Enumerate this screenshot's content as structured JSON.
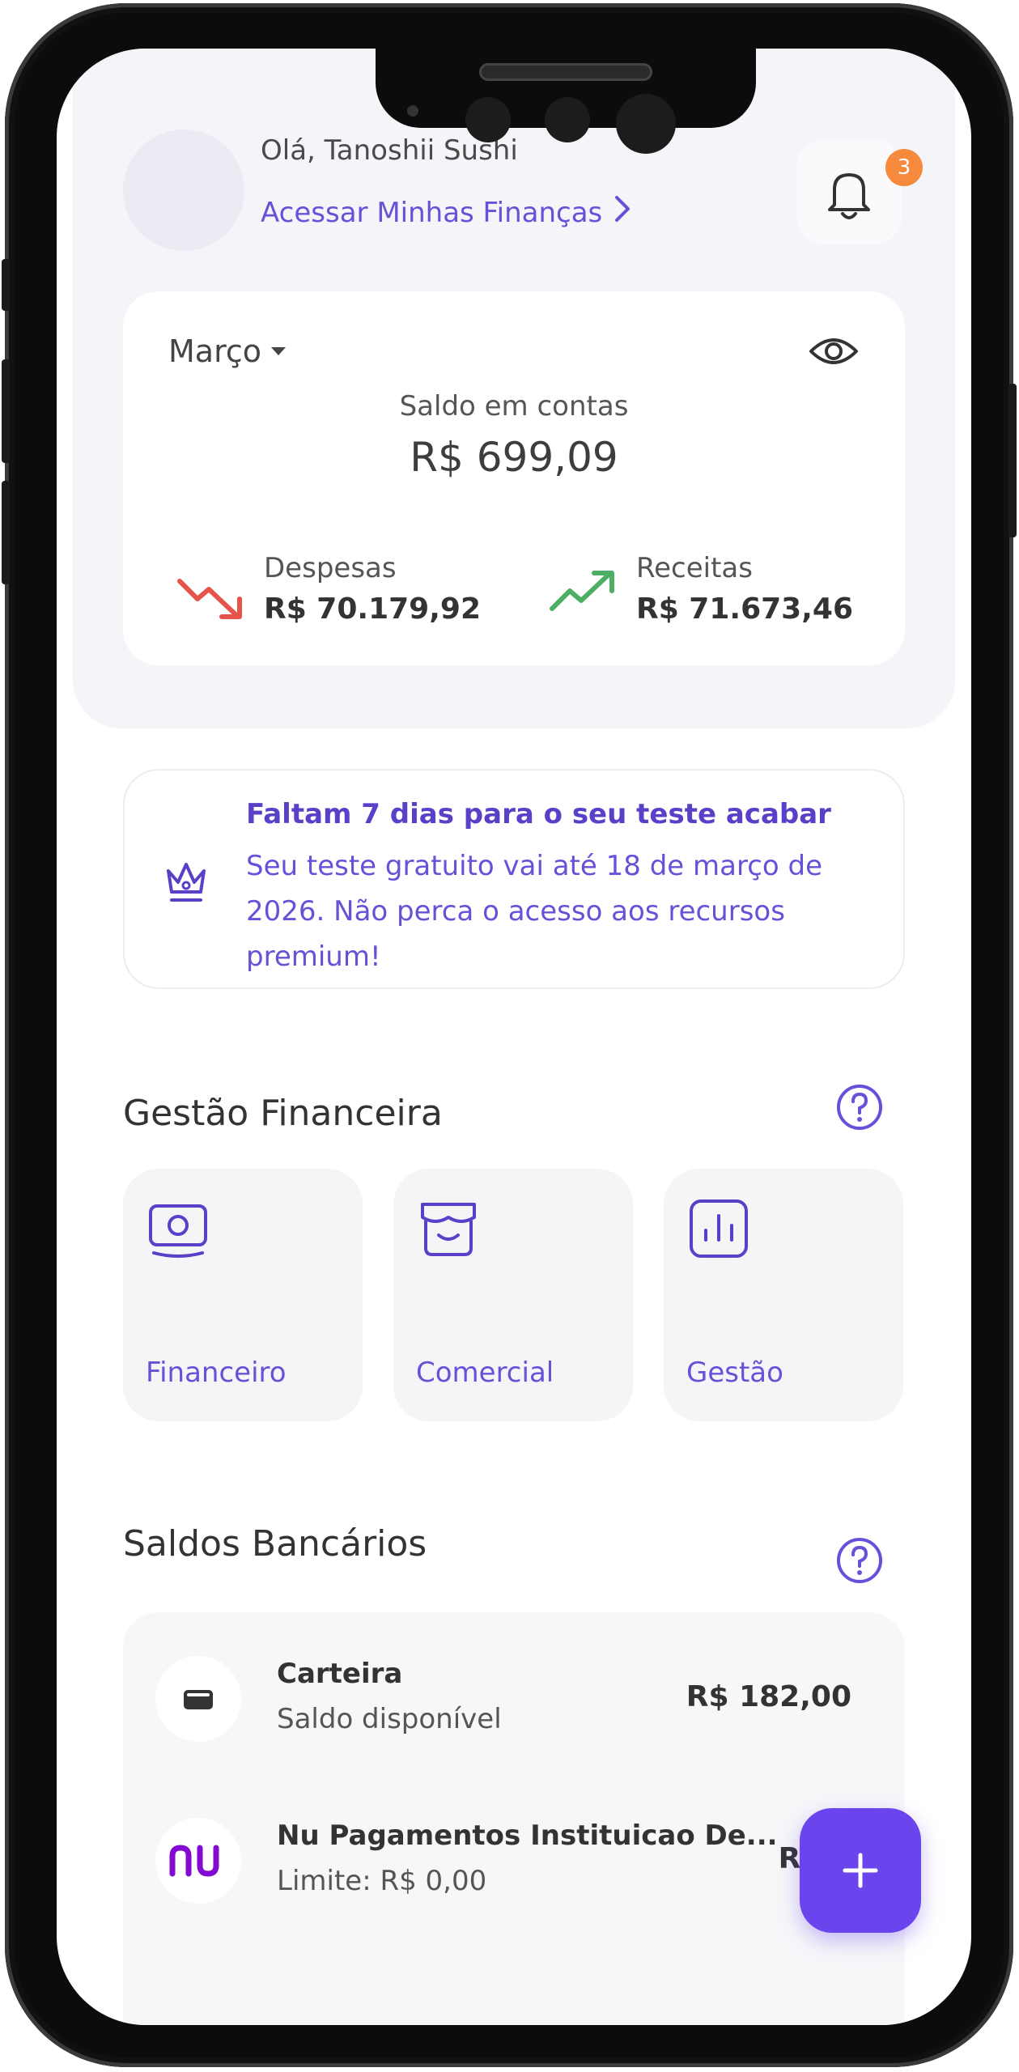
{
  "header": {
    "greeting": "Olá, Tanoshii Sushi",
    "finance_link": "Acessar Minhas Finanças",
    "notification_count": "3"
  },
  "balance": {
    "month": "Março",
    "label": "Saldo em contas",
    "value": "R$ 699,09",
    "expenses_label": "Despesas",
    "expenses_value": "R$ 70.179,92",
    "income_label": "Receitas",
    "income_value": "R$ 71.673,46"
  },
  "trial": {
    "title": "Faltam 7 dias para o seu teste acabar",
    "body": "Seu teste gratuito vai até 18 de março de 2026. Não perca o acesso aos recursos premium!"
  },
  "management": {
    "title": "Gestão Financeira",
    "tiles": [
      {
        "label": "Financeiro",
        "icon": "money-icon"
      },
      {
        "label": "Comercial",
        "icon": "store-icon"
      },
      {
        "label": "Gestão",
        "icon": "chart-icon"
      }
    ]
  },
  "banks": {
    "title": "Saldos Bancários",
    "accounts": [
      {
        "name": "Carteira",
        "sub": "Saldo disponível",
        "amount": "R$ 182,00",
        "icon": "wallet-icon"
      },
      {
        "name": "Nu Pagamentos Instituicao De...",
        "sub": "Limite: R$ 0,00",
        "amount": "R$ 0",
        "icon": "nu"
      }
    ]
  },
  "colors": {
    "accent": "#6a4fd8",
    "fab": "#6a45ee",
    "badge": "#f58a3d",
    "expense": "#e5534b",
    "income": "#4caf64",
    "nubank": "#820ad1"
  }
}
